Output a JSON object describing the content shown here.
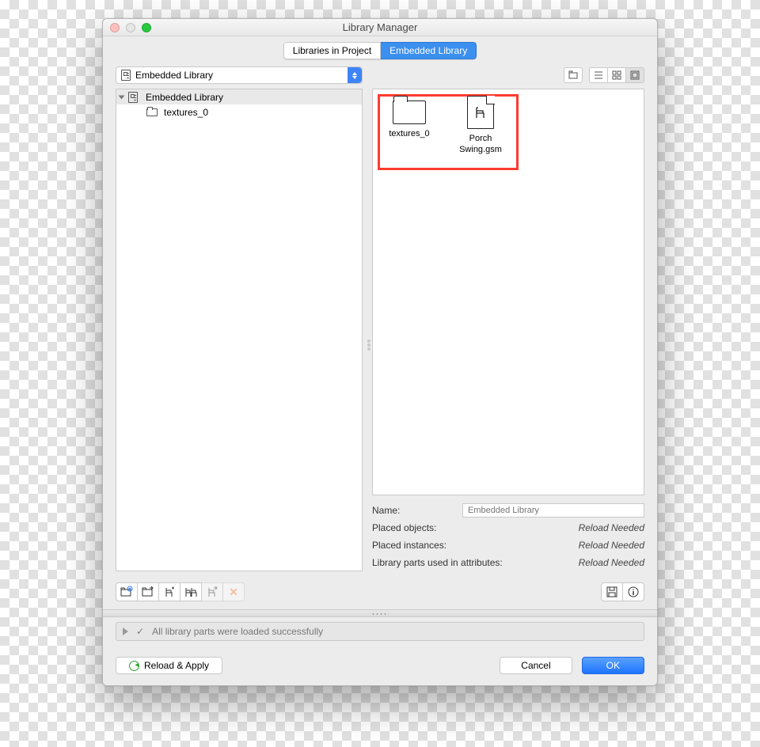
{
  "window": {
    "title": "Library Manager"
  },
  "tabs": {
    "left": "Libraries in Project",
    "right": "Embedded Library"
  },
  "dropdown": {
    "label": "Embedded Library"
  },
  "tree": {
    "root": "Embedded Library",
    "child": "textures_0"
  },
  "grid": {
    "item1": "textures_0",
    "item2_line1": "Porch",
    "item2_line2": "Swing.gsm"
  },
  "details": {
    "name_label": "Name:",
    "name_placeholder": "Embedded Library",
    "placed_objects_label": "Placed objects:",
    "placed_objects_value": "Reload Needed",
    "placed_instances_label": "Placed instances:",
    "placed_instances_value": "Reload Needed",
    "attr_label": "Library parts used in attributes:",
    "attr_value": "Reload Needed"
  },
  "status": {
    "message": "All library parts were loaded successfully"
  },
  "footer": {
    "reload": "Reload & Apply",
    "cancel": "Cancel",
    "ok": "OK"
  }
}
